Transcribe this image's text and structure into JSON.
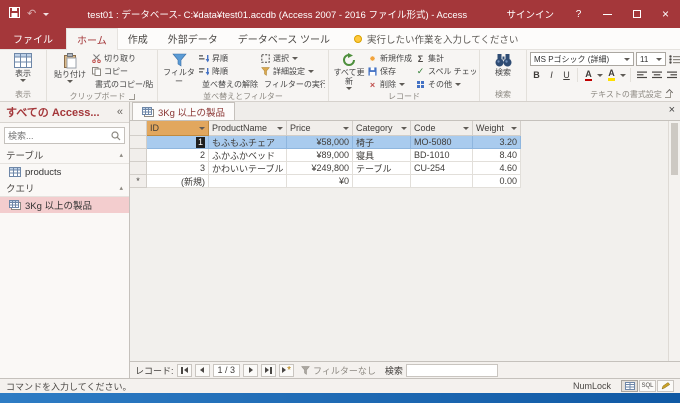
{
  "titlebar": {
    "title": "test01 : データベース- C:¥data¥test01.accdb (Access 2007 - 2016 ファイル形式) - Access",
    "signin": "サインイン",
    "help": "?"
  },
  "tabs": {
    "file": "ファイル",
    "home": "ホーム",
    "create": "作成",
    "external": "外部データ",
    "dbtools": "データベース ツール",
    "tellme": "実行したい作業を入力してください"
  },
  "ribbon": {
    "views": {
      "button": "表示",
      "caption": "表示"
    },
    "clipboard": {
      "paste": "貼り付け",
      "cut": "切り取り",
      "copy": "コピー",
      "painter": "書式のコピー/貼り付け",
      "caption": "クリップボード"
    },
    "sort": {
      "filter": "フィルター",
      "asc": "昇順",
      "desc": "降順",
      "clear": "並べ替えの解除",
      "selection": "選択",
      "advanced": "詳細設定",
      "toggle": "フィルターの実行",
      "caption": "並べ替えとフィルター"
    },
    "records": {
      "refresh": "すべて更新",
      "new": "新規作成",
      "save": "保存",
      "delete": "削除",
      "totals": "集計",
      "spelling": "スペル チェック",
      "more": "その他",
      "caption": "レコード"
    },
    "find": {
      "button": "検索",
      "caption": "検索"
    },
    "textfmt": {
      "font": "MS Pゴシック (詳細)",
      "size": "11",
      "bold": "B",
      "italic": "I",
      "underline": "U",
      "color_a": "A",
      "hl_a": "A",
      "caption": "テキストの書式設定"
    }
  },
  "navpane": {
    "title": "すべての Access...",
    "collapse_icon": "«",
    "search_placeholder": "検索...",
    "tables_group": "テーブル",
    "table_item": "products",
    "queries_group": "クエリ",
    "query_item": "3Kg 以上の製品"
  },
  "doc": {
    "tab": "3Kg 以上の製品"
  },
  "sheet": {
    "headers": [
      "ID",
      "ProductName",
      "Price",
      "Category",
      "Code",
      "Weight"
    ],
    "rows": [
      {
        "id": "1",
        "name": "もふもふチェア",
        "price": "¥58,000",
        "cat": "椅子",
        "code": "MO-5080",
        "wt": "3.20"
      },
      {
        "id": "2",
        "name": "ふかふかベッド",
        "price": "¥89,000",
        "cat": "寝具",
        "code": "BD-1010",
        "wt": "8.40"
      },
      {
        "id": "3",
        "name": "かわいいテーブル",
        "price": "¥249,800",
        "cat": "テーブル",
        "code": "CU-254",
        "wt": "4.60"
      }
    ],
    "newrow": {
      "marker": "*",
      "id": "(新規)",
      "price": "¥0",
      "wt": "0.00"
    }
  },
  "recnav": {
    "label": "レコード:",
    "counter": "1 / 3",
    "filter": "フィルターなし",
    "search": "検索"
  },
  "status": {
    "message": "コマンドを入力してください。",
    "numlock": "NumLock",
    "sql": "SQL"
  },
  "glyphs": {
    "undo": "↶",
    "sigma": "Σ",
    "check": "✓",
    "x": "×",
    "chevron": "▴",
    "star": "*"
  }
}
